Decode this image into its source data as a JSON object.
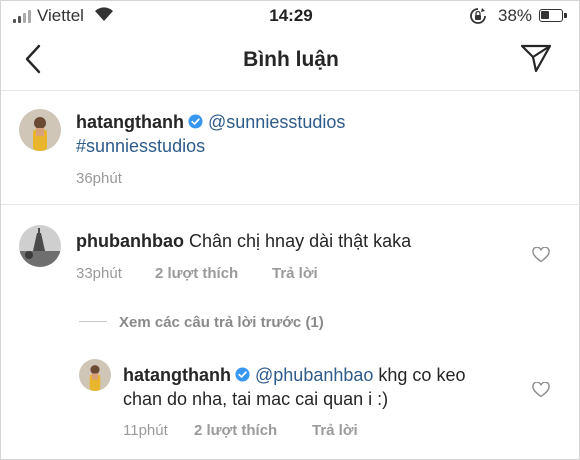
{
  "status_bar": {
    "carrier": "Viettel",
    "time": "14:29",
    "battery": "38%"
  },
  "header": {
    "title": "Bình luận",
    "icons": [
      "back-chevron-icon",
      "send-icon"
    ]
  },
  "caption": {
    "username": "hatangthanh",
    "verified": true,
    "mention": "@sunniesstudios",
    "hashtag": "#sunniesstudios",
    "time": "36phút"
  },
  "comment": {
    "username": "phubanhbao",
    "text": "Chân chị hnay dài thật kaka",
    "time": "33phút",
    "likes": "2 lượt thích",
    "reply": "Trả lời"
  },
  "view_previous": "Xem các câu trả lời trước (1)",
  "reply": {
    "username": "hatangthanh",
    "verified": true,
    "mention": "@phubanhbao",
    "text_inline": " khg co keo",
    "text_line2": "chan do nha, tai mac cai quan i :)",
    "time": "11phút",
    "likes": "2 lượt thích",
    "reply": "Trả lời"
  },
  "colors": {
    "mention": "#2e5b8a",
    "meta": "#9a9a9a",
    "verified": "#3897f0"
  }
}
